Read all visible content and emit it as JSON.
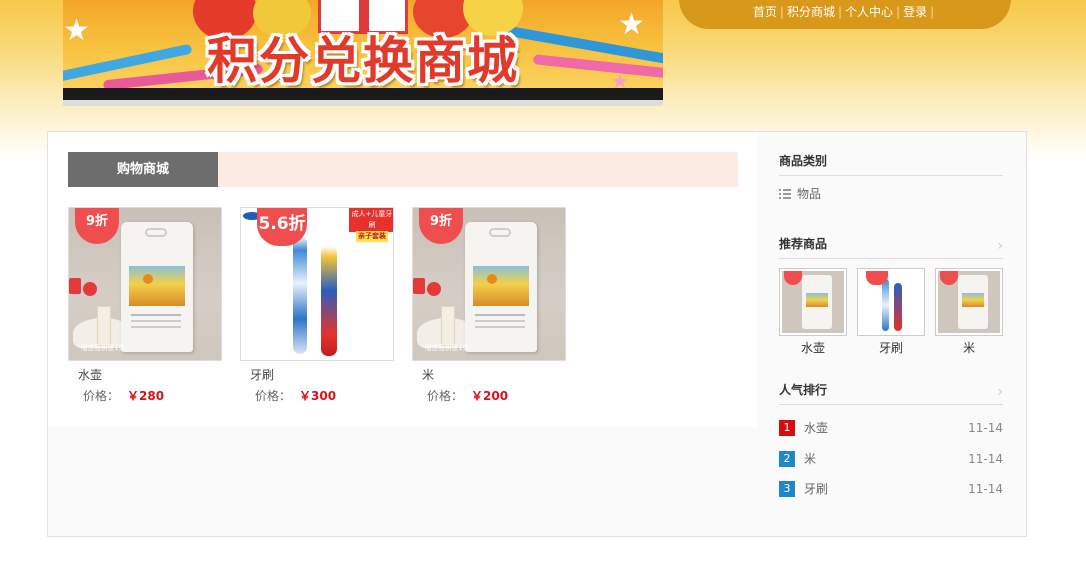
{
  "banner": {
    "title": "积分兑换商城"
  },
  "nav": {
    "items": [
      "首页",
      "积分商城",
      "个人中心",
      "登录"
    ],
    "separator": "|"
  },
  "shop": {
    "tab_label": "购物商城",
    "price_label": "价格：",
    "products": [
      {
        "name": "水壶",
        "price": "￥280",
        "discount": "9折",
        "caption": "赠送瓶树篮1条"
      },
      {
        "name": "牙刷",
        "price": "￥300",
        "discount": "5.6折",
        "tag_line1": "成人+儿童牙刷",
        "tag_line2": "亲子套装"
      },
      {
        "name": "米",
        "price": "￥200",
        "discount": "9折",
        "caption": "赠送瓶树篮1条"
      }
    ]
  },
  "sidebar": {
    "category_title": "商品类别",
    "categories": [
      "物品"
    ],
    "recommend_title": "推荐商品",
    "recommend": [
      {
        "name": "水壶"
      },
      {
        "name": "牙刷"
      },
      {
        "name": "米"
      }
    ],
    "popular_title": "人气排行",
    "popular": [
      {
        "rank": "1",
        "name": "水壶",
        "date": "11-14"
      },
      {
        "rank": "2",
        "name": "米",
        "date": "11-14"
      },
      {
        "rank": "3",
        "name": "牙刷",
        "date": "11-14"
      }
    ],
    "arrow_glyph": "›"
  },
  "colors": {
    "nav_bg": "#d8981a",
    "tab_active_bg": "#6d6d6d",
    "tab_bar_bg": "#fbebe3",
    "price": "#d8121a",
    "rank_first": "#d20e0e",
    "rank_other": "#1f87c7"
  }
}
